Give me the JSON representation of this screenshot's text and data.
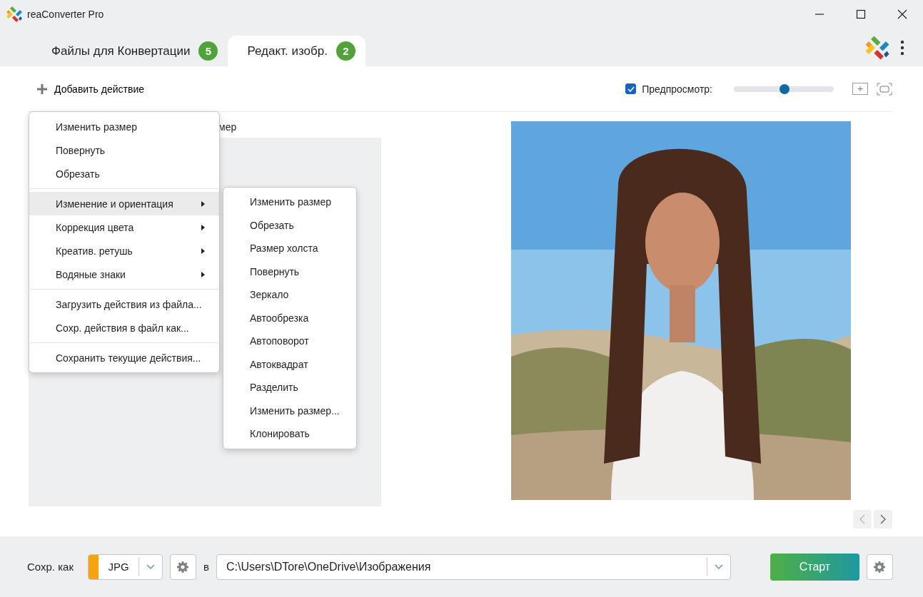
{
  "window": {
    "title": "reaConverter Pro"
  },
  "tabs": [
    {
      "label": "Файлы для Конвертации",
      "badge": "5",
      "selected": false
    },
    {
      "label": "Редакт. изобр.",
      "badge": "2",
      "selected": true
    }
  ],
  "toolbar": {
    "add_action": "Добавить действие",
    "preview": {
      "label": "Предпросмотр:",
      "checked": true
    },
    "zoom_slider": {
      "level": 0.51
    }
  },
  "actions_panel": {
    "header": "мер"
  },
  "menu": {
    "groups": [
      [
        {
          "label": "Изменить размер",
          "selected": false,
          "has_submenu": false
        },
        {
          "label": "Повернуть",
          "selected": false,
          "has_submenu": false
        },
        {
          "label": "Обрезать",
          "selected": false,
          "has_submenu": false
        }
      ],
      [
        {
          "label": "Изменение и ориентация",
          "selected": true,
          "has_submenu": true
        },
        {
          "label": "Коррекция цвета",
          "selected": false,
          "has_submenu": true
        },
        {
          "label": "Креатив. ретушь",
          "selected": false,
          "has_submenu": true
        },
        {
          "label": "Водяные знаки",
          "selected": false,
          "has_submenu": true
        }
      ],
      [
        {
          "label": "Загрузить действия из файла...",
          "selected": false,
          "has_submenu": false
        },
        {
          "label": "Сохр. действия в файл как...",
          "selected": false,
          "has_submenu": false
        }
      ],
      [
        {
          "label": "Сохранить текущие действия...",
          "selected": false,
          "has_submenu": false
        }
      ]
    ]
  },
  "submenu": {
    "items": [
      "Изменить размер",
      "Обрезать",
      "Размер холста",
      "Повернуть",
      "Зеркало",
      "Автообрезка",
      "Автоповорот",
      "Автоквадрат",
      "Разделить",
      "Изменить размер...",
      "Клонировать"
    ]
  },
  "bottom_bar": {
    "save_as_label": "Сохр. как",
    "format": "JPG",
    "in_label": "в",
    "path": "C:\\Users\\DTore\\OneDrive\\Изображения",
    "start": "Старт"
  }
}
